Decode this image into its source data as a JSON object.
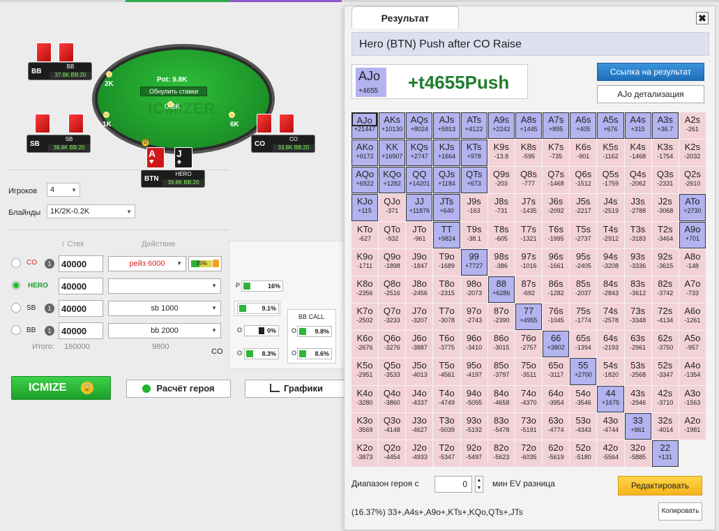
{
  "table": {
    "pot_label": "Pot: 9.8K",
    "reset_label": "Обнулить ставки",
    "watermark": "ICMIZER",
    "center_bet": "0.8K",
    "bets": {
      "bb": "2K",
      "sb": "1K",
      "co": "6K"
    },
    "seats": {
      "bb": {
        "pos": "BB",
        "name": "BB",
        "stack": "37.8K BB:20"
      },
      "sb": {
        "pos": "SB",
        "name": "SB",
        "stack": "38.8K BB:20"
      },
      "co": {
        "pos": "CO",
        "name": "CO",
        "stack": "33.8K BB:20"
      },
      "btn": {
        "pos": "BTN",
        "name": "HERO",
        "stack": "39.8K BB:20"
      }
    },
    "hero_cards": [
      {
        "rank": "A",
        "suit": "♥"
      },
      {
        "rank": "J",
        "suit": "♠"
      }
    ]
  },
  "settings": {
    "players_label": "Игроков",
    "players_value": "4",
    "blinds_label": "Блайнды",
    "blinds_value": "1K/2K-0.2K"
  },
  "players": {
    "stack_header": "Стек",
    "action_header": "Действие",
    "rows": [
      {
        "pos": "CO",
        "num": "1",
        "stack": "40000",
        "action": "рейз 6000",
        "extra": "35%"
      },
      {
        "pos": "HERO",
        "num": "",
        "stack": "40000",
        "action": ""
      },
      {
        "pos": "SB",
        "num": "1",
        "stack": "40000",
        "action": "sb 1000"
      },
      {
        "pos": "BB",
        "num": "1",
        "stack": "40000",
        "action": "bb 2000"
      }
    ],
    "totals_label": "Итого:",
    "total_stack": "160000",
    "total_action": "9800",
    "co_label": "CO"
  },
  "equity": {
    "p_label": "P",
    "p_value": "16%",
    "v2": "9.1%",
    "o_label": "O",
    "v3": "0%",
    "v4": "8.3%",
    "bb_call_label": "BB CALL",
    "v5": "9.8%",
    "v6": "8.6%"
  },
  "buttons": {
    "icmize": "ICMIZE",
    "hero_calc": "Расчёт героя",
    "graphs": "Графики"
  },
  "result": {
    "tab_label": "Результат",
    "close_label": "✖",
    "title": "Hero (BTN) Push after CO Raise",
    "hand": "AJo",
    "hand_ev": "+4655",
    "big_text": "+t4655Push",
    "link_button": "Ссылка на результат",
    "detail_button": "AJo детализация",
    "range_label": "Диапазон героя с",
    "range_value": "0",
    "ev_label": "мин EV разница",
    "edit_button": "Редактировать",
    "range_text": "(16.37%) 33+,A4s+,A9o+,KTs+,KQo,QTs+,JTs",
    "copy_button": "Копировать"
  },
  "matrix": [
    [
      [
        "AA",
        "+21447",
        1
      ],
      [
        "AKs",
        "+10130",
        1
      ],
      [
        "AQs",
        "+8024",
        1
      ],
      [
        "AJs",
        "+5913",
        1
      ],
      [
        "ATs",
        "+4122",
        1
      ],
      [
        "A9s",
        "+2242",
        1
      ],
      [
        "A8s",
        "+1445",
        1
      ],
      [
        "A7s",
        "+895",
        1
      ],
      [
        "A6s",
        "+405",
        1
      ],
      [
        "A5s",
        "+676",
        1
      ],
      [
        "A4s",
        "+315",
        1
      ],
      [
        "A3s",
        "+36.7",
        1
      ],
      [
        "A2s",
        "-261",
        0
      ]
    ],
    [
      [
        "AKo",
        "+9172",
        1
      ],
      [
        "KK",
        "+16907",
        1
      ],
      [
        "KQs",
        "+2747",
        1
      ],
      [
        "KJs",
        "+1664",
        1
      ],
      [
        "KTs",
        "+978",
        1
      ],
      [
        "K9s",
        "-13.8",
        0
      ],
      [
        "K8s",
        "-595",
        0
      ],
      [
        "K7s",
        "-735",
        0
      ],
      [
        "K6s",
        "-901",
        0
      ],
      [
        "K5s",
        "-1162",
        0
      ],
      [
        "K4s",
        "-1468",
        0
      ],
      [
        "K3s",
        "-1754",
        0
      ],
      [
        "K2s",
        "-2032",
        0
      ]
    ],
    [
      [
        "AQo",
        "+6922",
        1
      ],
      [
        "KQo",
        "+1282",
        1
      ],
      [
        "QQ",
        "+14201",
        1
      ],
      [
        "QJs",
        "+1184",
        1
      ],
      [
        "QTs",
        "+673",
        1
      ],
      [
        "Q9s",
        "-203",
        0
      ],
      [
        "Q8s",
        "-777",
        0
      ],
      [
        "Q7s",
        "-1468",
        0
      ],
      [
        "Q6s",
        "-1512",
        0
      ],
      [
        "Q5s",
        "-1759",
        0
      ],
      [
        "Q4s",
        "-2062",
        0
      ],
      [
        "Q3s",
        "-2331",
        0
      ],
      [
        "Q2s",
        "-2610",
        0
      ]
    ],
    [
      [
        "AJo",
        "+4655",
        1
      ],
      [
        "KJo",
        "+115",
        1
      ],
      [
        "QJo",
        "-371",
        0
      ],
      [
        "JJ",
        "+11876",
        1
      ],
      [
        "JTs",
        "+640",
        1
      ],
      [
        "J9s",
        "-163",
        0
      ],
      [
        "J8s",
        "-731",
        0
      ],
      [
        "J7s",
        "-1435",
        0
      ],
      [
        "J6s",
        "-2092",
        0
      ],
      [
        "J5s",
        "-2217",
        0
      ],
      [
        "J4s",
        "-2519",
        0
      ],
      [
        "J3s",
        "-2788",
        0
      ],
      [
        "J2s",
        "-3068",
        0
      ]
    ],
    [
      [
        "ATo",
        "+2730",
        1
      ],
      [
        "KTo",
        "-627",
        0
      ],
      [
        "QTo",
        "-932",
        0
      ],
      [
        "JTo",
        "-961",
        0
      ],
      [
        "TT",
        "+9824",
        1
      ],
      [
        "T9s",
        "-38.1",
        0
      ],
      [
        "T8s",
        "-605",
        0
      ],
      [
        "T7s",
        "-1321",
        0
      ],
      [
        "T6s",
        "-1995",
        0
      ],
      [
        "T5s",
        "-2737",
        0
      ],
      [
        "T4s",
        "-2912",
        0
      ],
      [
        "T3s",
        "-3183",
        0
      ],
      [
        "T2s",
        "-3464",
        0
      ]
    ],
    [
      [
        "A9o",
        "+701",
        1
      ],
      [
        "K9o",
        "-1711",
        0
      ],
      [
        "Q9o",
        "-1898",
        0
      ],
      [
        "J9o",
        "-1847",
        0
      ],
      [
        "T9o",
        "-1689",
        0
      ],
      [
        "99",
        "+7727",
        1
      ],
      [
        "98s",
        "-386",
        0
      ],
      [
        "97s",
        "-1016",
        0
      ],
      [
        "96s",
        "-1661",
        0
      ],
      [
        "95s",
        "-2405",
        0
      ],
      [
        "94s",
        "-3208",
        0
      ],
      [
        "93s",
        "-3336",
        0
      ],
      [
        "92s",
        "-3615",
        0
      ]
    ],
    [
      [
        "A8o",
        "-148",
        0
      ],
      [
        "K8o",
        "-2356",
        0
      ],
      [
        "Q8o",
        "-2516",
        0
      ],
      [
        "J8o",
        "-2456",
        0
      ],
      [
        "T8o",
        "-2315",
        0
      ],
      [
        "98o",
        "-2073",
        0
      ],
      [
        "88",
        "+6286",
        1
      ],
      [
        "87s",
        "-692",
        0
      ],
      [
        "86s",
        "-1282",
        0
      ],
      [
        "85s",
        "-2037",
        0
      ],
      [
        "84s",
        "-2843",
        0
      ],
      [
        "83s",
        "-3612",
        0
      ],
      [
        "82s",
        "-3742",
        0
      ]
    ],
    [
      [
        "A7o",
        "-733",
        0
      ],
      [
        "K7o",
        "-2502",
        0
      ],
      [
        "Q7o",
        "-3233",
        0
      ],
      [
        "J7o",
        "-3207",
        0
      ],
      [
        "T7o",
        "-3078",
        0
      ],
      [
        "97o",
        "-2743",
        0
      ],
      [
        "87o",
        "-2390",
        0
      ],
      [
        "77",
        "+4955",
        1
      ],
      [
        "76s",
        "-1045",
        0
      ],
      [
        "75s",
        "-1774",
        0
      ],
      [
        "74s",
        "-2578",
        0
      ],
      [
        "73s",
        "-3348",
        0
      ],
      [
        "72s",
        "-4134",
        0
      ]
    ],
    [
      [
        "A6o",
        "-1261",
        0
      ],
      [
        "K6o",
        "-2676",
        0
      ],
      [
        "Q6o",
        "-3276",
        0
      ],
      [
        "J6o",
        "-3887",
        0
      ],
      [
        "T6o",
        "-3775",
        0
      ],
      [
        "96o",
        "-3410",
        0
      ],
      [
        "86o",
        "-3015",
        0
      ],
      [
        "76o",
        "-2757",
        0
      ],
      [
        "66",
        "+3802",
        1
      ],
      [
        "65s",
        "-1394",
        0
      ],
      [
        "64s",
        "-2193",
        0
      ],
      [
        "63s",
        "-2961",
        0
      ],
      [
        "62s",
        "-3750",
        0
      ]
    ],
    [
      [
        "A5o",
        "-957",
        0
      ],
      [
        "K5o",
        "-2951",
        0
      ],
      [
        "Q5o",
        "-3533",
        0
      ],
      [
        "J5o",
        "-4013",
        0
      ],
      [
        "T5o",
        "-4561",
        0
      ],
      [
        "95o",
        "-4197",
        0
      ],
      [
        "85o",
        "-3797",
        0
      ],
      [
        "75o",
        "-3511",
        0
      ],
      [
        "65o",
        "-3117",
        0
      ],
      [
        "55",
        "+2700",
        1
      ],
      [
        "54s",
        "-1820",
        0
      ],
      [
        "53s",
        "-2568",
        0
      ],
      [
        "52s",
        "-3347",
        0
      ]
    ],
    [
      [
        "A4o",
        "-1354",
        0
      ],
      [
        "K4o",
        "-3280",
        0
      ],
      [
        "Q4o",
        "-3860",
        0
      ],
      [
        "J4o",
        "-4337",
        0
      ],
      [
        "T4o",
        "-4749",
        0
      ],
      [
        "94o",
        "-5055",
        0
      ],
      [
        "84o",
        "-4658",
        0
      ],
      [
        "74o",
        "-4370",
        0
      ],
      [
        "64o",
        "-3954",
        0
      ],
      [
        "54o",
        "-3546",
        0
      ],
      [
        "44",
        "+1675",
        1
      ],
      [
        "43s",
        "-2946",
        0
      ],
      [
        "42s",
        "-3710",
        0
      ]
    ],
    [
      [
        "A3o",
        "-1563",
        0
      ],
      [
        "K3o",
        "-3569",
        0
      ],
      [
        "Q3o",
        "-4148",
        0
      ],
      [
        "J3o",
        "-4627",
        0
      ],
      [
        "T3o",
        "-5039",
        0
      ],
      [
        "93o",
        "-5192",
        0
      ],
      [
        "83o",
        "-5478",
        0
      ],
      [
        "73o",
        "-5191",
        0
      ],
      [
        "63o",
        "-4774",
        0
      ],
      [
        "53o",
        "-4343",
        0
      ],
      [
        "43o",
        "-4744",
        0
      ],
      [
        "33",
        "+861",
        1
      ],
      [
        "32s",
        "-4014",
        0
      ]
    ],
    [
      [
        "A2o",
        "-1981",
        0
      ],
      [
        "K2o",
        "-3873",
        0
      ],
      [
        "Q2o",
        "-4454",
        0
      ],
      [
        "J2o",
        "-4933",
        0
      ],
      [
        "T2o",
        "-5347",
        0
      ],
      [
        "92o",
        "-5497",
        0
      ],
      [
        "82o",
        "-5623",
        0
      ],
      [
        "72o",
        "-6035",
        0
      ],
      [
        "62o",
        "-5619",
        0
      ],
      [
        "52o",
        "-5180",
        0
      ],
      [
        "42o",
        "-5564",
        0
      ],
      [
        "32o",
        "-5885",
        0
      ],
      [
        "22",
        "+131",
        1
      ]
    ]
  ]
}
